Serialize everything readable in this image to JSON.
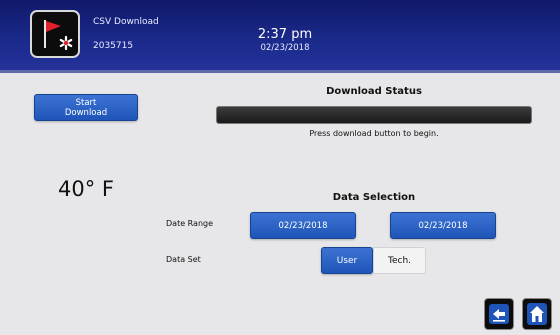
{
  "header": {
    "title": "CSV Download",
    "serial": "2035715",
    "time": "2:37 pm",
    "date": "02/23/2018",
    "app_icon": "flag-alert-icon"
  },
  "download": {
    "start_label_line1": "Start",
    "start_label_line2": "Download",
    "status_title": "Download Status",
    "progress_fraction": 0,
    "status_message": "Press download button to begin."
  },
  "temperature": "40° F",
  "selection": {
    "title": "Data Selection",
    "date_range_label": "Date Range",
    "date_start": "02/23/2018",
    "date_end": "02/23/2018",
    "data_set_label": "Data Set",
    "data_set_options": [
      "User",
      "Tech."
    ],
    "data_set_selected": "User"
  },
  "nav": {
    "back_icon": "back-arrow-icon",
    "home_icon": "home-icon"
  },
  "colors": {
    "header_bg": "#1b2a8c",
    "button_blue": "#2a63c8",
    "background": "#e7e7e9",
    "alert_red": "#e0202a"
  }
}
